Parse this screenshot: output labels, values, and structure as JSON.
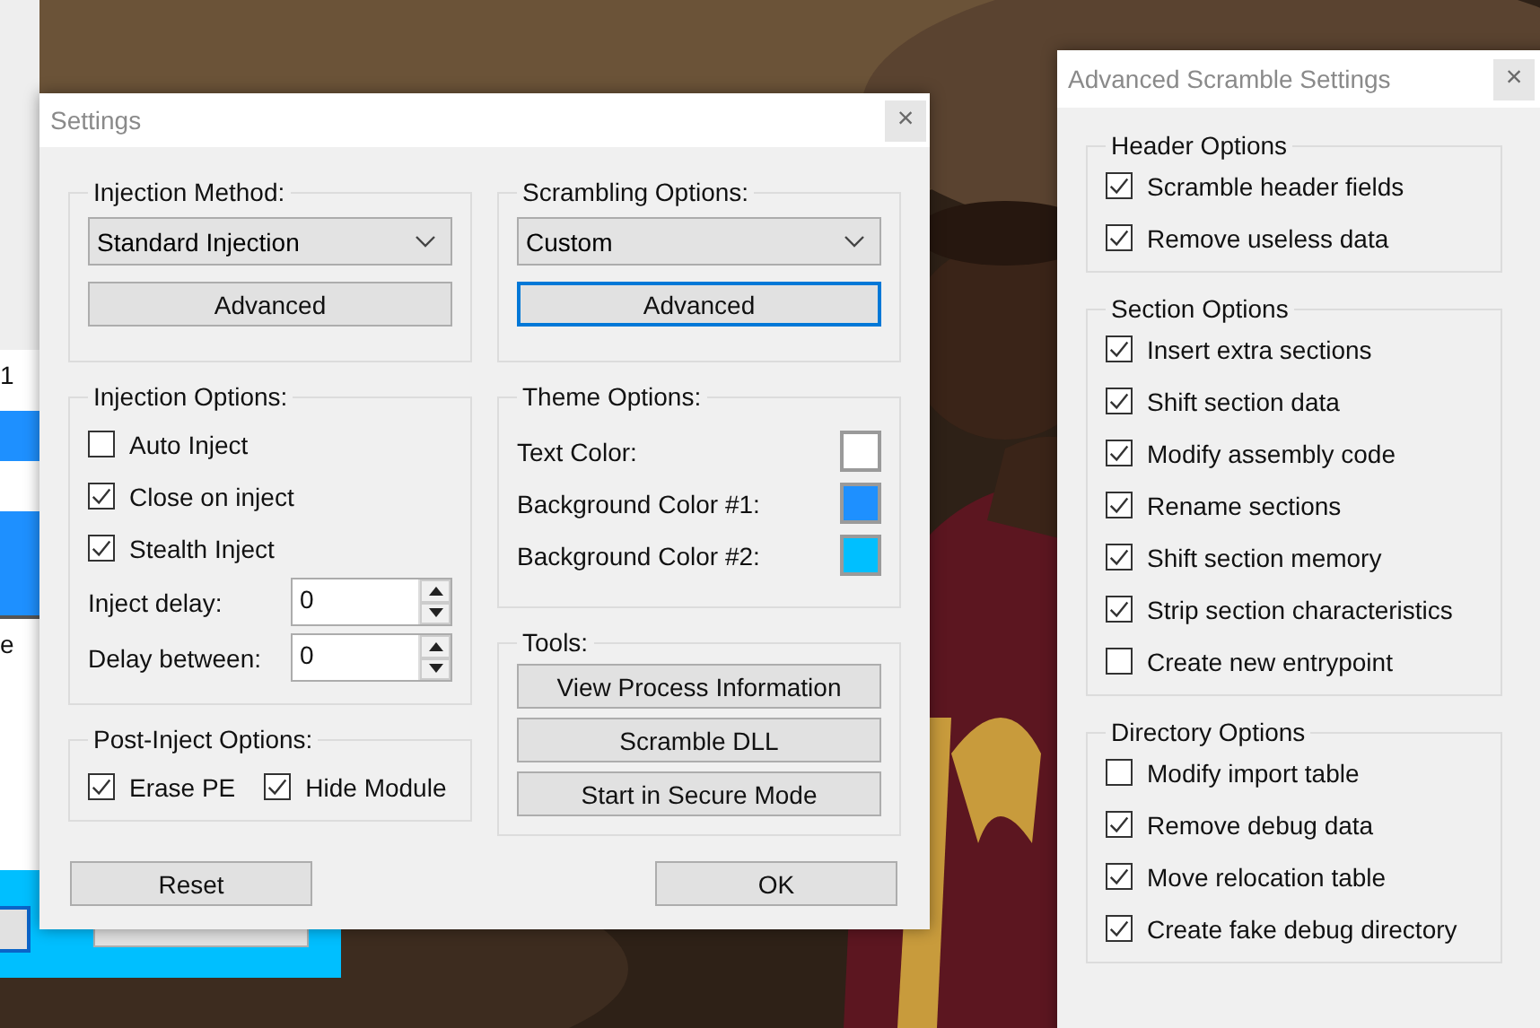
{
  "background_window": {
    "partial_texts": [
      "1",
      "e"
    ]
  },
  "settings_window": {
    "title": "Settings",
    "close": "×",
    "injection_method": {
      "label": "Injection Method:",
      "dropdown": "Standard Injection",
      "button": {
        "label": "Advanced",
        "focused": false
      }
    },
    "injection_options": {
      "label": "Injection Options:",
      "checkboxes": [
        {
          "label": "Auto Inject",
          "checked": false
        },
        {
          "label": "Close on inject",
          "checked": true
        },
        {
          "label": "Stealth Inject",
          "checked": true
        }
      ],
      "spinners": [
        {
          "label": "Inject delay:",
          "value": "0"
        },
        {
          "label": "Delay between:",
          "value": "0"
        }
      ]
    },
    "post_inject_options": {
      "label": "Post-Inject Options:",
      "checkboxes": [
        {
          "label": "Erase PE",
          "checked": true
        },
        {
          "label": "Hide Module",
          "checked": true
        }
      ]
    },
    "scrambling_options": {
      "label": "Scrambling Options:",
      "dropdown": "Custom",
      "button": {
        "label": "Advanced",
        "focused": true
      }
    },
    "theme_options": {
      "label": "Theme Options:",
      "colors": [
        {
          "label": "Text Color:",
          "color": "#ffffff"
        },
        {
          "label": "Background Color #1:",
          "color": "#1e90ff"
        },
        {
          "label": "Background Color #2:",
          "color": "#00bfff"
        }
      ]
    },
    "tools": {
      "label": "Tools:",
      "buttons": [
        "View Process Information",
        "Scramble DLL",
        "Start in Secure Mode"
      ]
    },
    "buttons": [
      "Reset",
      "OK"
    ]
  },
  "advanced_window": {
    "title": "Advanced Scramble Settings",
    "close": "×",
    "groups": [
      {
        "title": "Header Options",
        "options": [
          {
            "label": "Scramble header fields",
            "checked": true
          },
          {
            "label": "Remove useless data",
            "checked": true
          }
        ]
      },
      {
        "title": "Section Options",
        "options": [
          {
            "label": "Insert extra sections",
            "checked": true
          },
          {
            "label": "Shift section data",
            "checked": true
          },
          {
            "label": "Modify assembly code",
            "checked": true
          },
          {
            "label": "Rename sections",
            "checked": true
          },
          {
            "label": "Shift section memory",
            "checked": true
          },
          {
            "label": "Strip section characteristics",
            "checked": true
          },
          {
            "label": "Create new entrypoint",
            "checked": false
          }
        ]
      },
      {
        "title": "Directory Options",
        "options": [
          {
            "label": "Modify import table",
            "checked": false
          },
          {
            "label": "Remove debug data",
            "checked": true
          },
          {
            "label": "Move relocation table",
            "checked": true
          },
          {
            "label": "Create fake debug directory",
            "checked": true
          }
        ]
      }
    ]
  }
}
